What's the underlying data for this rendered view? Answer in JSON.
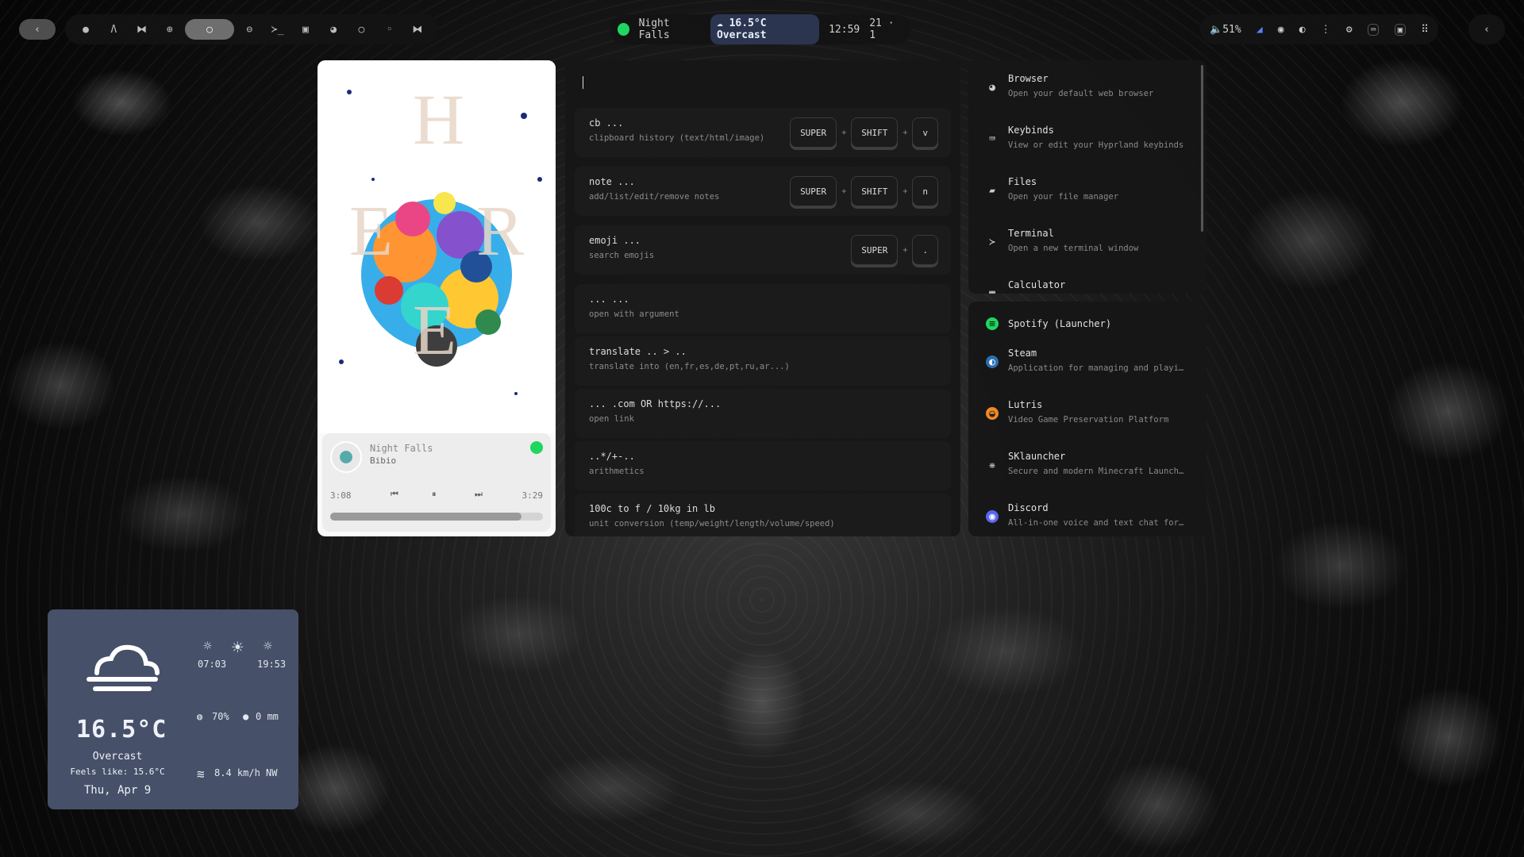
{
  "topbar": {
    "back_icon": "chevron-left-icon",
    "workspaces": [
      "●",
      "Ʌ",
      "⧓",
      "⊕",
      "○",
      "⊖",
      "≻_",
      "▣",
      "◕",
      "○",
      "◦",
      "⧓"
    ],
    "now_playing": "Night Falls",
    "weather": "16.5°C Overcast",
    "time": "12:59",
    "date": "21 · 1",
    "volume": "51%",
    "right_icons": [
      "wifi-icon",
      "discord-icon",
      "steam-icon",
      "more-icon",
      "settings-icon",
      "keyboard-icon",
      "screenshot-icon",
      "grid-icon"
    ],
    "expand_icon": "chevron-left-icon"
  },
  "player": {
    "title": "Night Falls",
    "artist": "Bibio",
    "elapsed": "3:08",
    "duration": "3:29",
    "progress": 0.9,
    "art_letters": [
      "H",
      "E",
      "R",
      "E",
      "H"
    ]
  },
  "launcher": {
    "commands": [
      {
        "name": "cb ...",
        "desc": "clipboard history (text/html/image)",
        "keys": [
          "SUPER",
          "SHIFT",
          "v"
        ]
      },
      {
        "name": "note ...",
        "desc": "add/list/edit/remove notes",
        "keys": [
          "SUPER",
          "SHIFT",
          "n"
        ]
      },
      {
        "name": "emoji ...",
        "desc": "search emojis",
        "keys": [
          "SUPER",
          "."
        ]
      },
      {
        "name": "... ...",
        "desc": "open with argument",
        "keys": []
      },
      {
        "name": "translate .. > ..",
        "desc": "translate into (en,fr,es,de,pt,ru,ar...)",
        "keys": []
      },
      {
        "name": "... .com OR https://...",
        "desc": "open link",
        "keys": []
      },
      {
        "name": "..*/+-..",
        "desc": "arithmetics",
        "keys": []
      },
      {
        "name": "100c to f / 10kg in lb",
        "desc": "unit conversion (temp/weight/length/volume/speed)",
        "keys": []
      }
    ],
    "plus": "+"
  },
  "apps_top": [
    {
      "name": "Browser",
      "desc": "Open your default web browser",
      "icon": "globe-icon"
    },
    {
      "name": "Keybinds",
      "desc": "View or edit your Hyprland keybinds",
      "icon": "keyboard-icon"
    },
    {
      "name": "Files",
      "desc": "Open your file manager",
      "icon": "folder-icon"
    },
    {
      "name": "Terminal",
      "desc": "Open a new terminal window",
      "icon": "terminal-icon"
    },
    {
      "name": "Calculator",
      "desc": "",
      "icon": "calculator-icon"
    }
  ],
  "apps_bottom": [
    {
      "name": "Spotify (Launcher)",
      "desc": "",
      "icon": "spotify-icon",
      "color": "#1ed760"
    },
    {
      "name": "Steam",
      "desc": "Application for managing and playi…",
      "icon": "steam-icon",
      "color": "#2a6fb0"
    },
    {
      "name": "Lutris",
      "desc": "Video Game Preservation Platform",
      "icon": "lutris-icon",
      "color": "#f08a24"
    },
    {
      "name": "SKlauncher",
      "desc": "Secure and modern Minecraft Launch…",
      "icon": "sklauncher-icon",
      "color": "#bbbbbb"
    },
    {
      "name": "Discord",
      "desc": "All-in-one voice and text chat for…",
      "icon": "discord-icon",
      "color": "#5865f2"
    }
  ],
  "weather": {
    "temp": "16.5°C",
    "condition": "Overcast",
    "feels_like": "Feels like: 15.6°C",
    "date": "Thu, Apr 9",
    "sunrise": "07:03",
    "sunset": "19:53",
    "humidity": "70%",
    "precip": "0 mm",
    "wind": "8.4 km/h NW"
  }
}
